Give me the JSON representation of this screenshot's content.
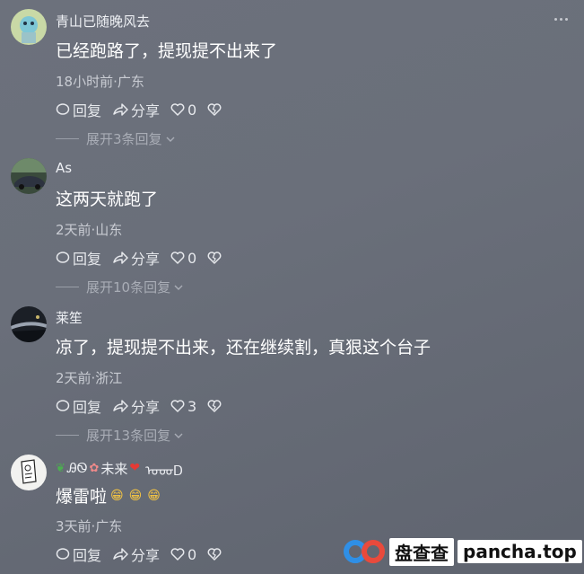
{
  "comments": [
    {
      "username": "青山已随晚风去",
      "text": "已经跑路了，提现提不出来了",
      "meta": "18小时前·广东",
      "reply_label": "回复",
      "share_label": "分享",
      "likes": "0",
      "expand_label": "展开3条回复"
    },
    {
      "username": "As",
      "text": "这两天就跑了",
      "meta": "2天前·山东",
      "reply_label": "回复",
      "share_label": "分享",
      "likes": "0",
      "expand_label": "展开10条回复"
    },
    {
      "username": "莱笙",
      "text": "凉了，提现提不出来，还在继续割，真狠这个台子",
      "meta": "2天前·浙江",
      "reply_label": "回复",
      "share_label": "分享",
      "likes": "3",
      "expand_label": "展开13条回复"
    },
    {
      "username_parts": [
        "ᎯᏫ",
        "未来",
        "ᠣᡂᎠ"
      ],
      "text": "爆雷啦",
      "emoji": "😁😁😁",
      "meta": "3天前·广东",
      "reply_label": "回复",
      "share_label": "分享",
      "likes": "0"
    }
  ],
  "watermark": {
    "brand": "盘查查",
    "domain": "pancha.top"
  },
  "colors": {
    "background": "#6a6f7a",
    "meta_text": "#c9ccd3",
    "expand_text": "#a9adb6"
  }
}
